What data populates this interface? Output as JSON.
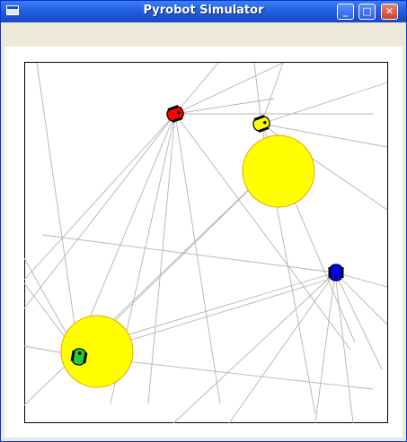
{
  "window": {
    "title": "Pyrobot Simulator"
  },
  "titlebar_buttons": {
    "minimize": "_",
    "maximize": "□",
    "close": "✕"
  },
  "colors": {
    "titlebar": "#2563e0",
    "light": "#ffff00",
    "light_edge": "#e6a800",
    "ray": "#b4b4b4",
    "robot_red": "#ff0000",
    "robot_yellow": "#ffff00",
    "robot_blue": "#0000ff",
    "robot_green": "#22cc33"
  },
  "icons": [
    "window-icon",
    "minimize-icon",
    "maximize-icon",
    "close-icon"
  ],
  "lights": [
    "light-top-right",
    "light-bottom-left"
  ],
  "robots": [
    {
      "id": "red",
      "color": "#ff0000"
    },
    {
      "id": "yellow",
      "color": "#ffff00"
    },
    {
      "id": "blue",
      "color": "#0000ff"
    },
    {
      "id": "green",
      "color": "#22cc33"
    }
  ]
}
